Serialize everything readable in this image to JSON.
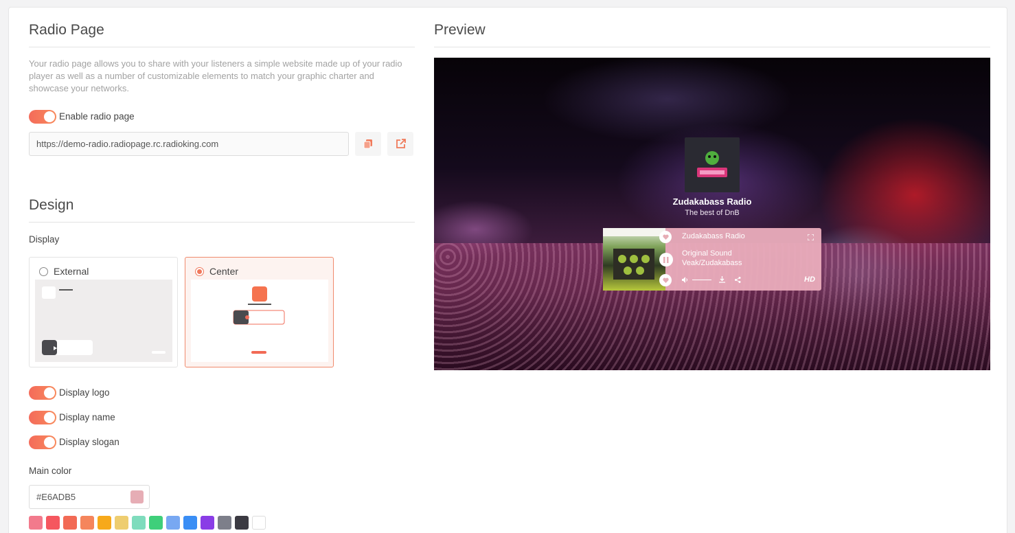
{
  "radio_page": {
    "title": "Radio Page",
    "description": "Your radio page allows you to share with your listeners a simple website made up of your radio player as well as a number of customizable elements to match your graphic charter and showcase your networks.",
    "enable_label": "Enable radio page",
    "enabled": true,
    "url": "https://demo-radio.radiopage.rc.radioking.com",
    "copy_icon": "copy-icon",
    "open_icon": "external-link-icon"
  },
  "design": {
    "title": "Design",
    "display_label": "Display",
    "options": [
      {
        "label": "External",
        "selected": false
      },
      {
        "label": "Center",
        "selected": true
      }
    ],
    "toggles": [
      {
        "label": "Display logo",
        "on": true
      },
      {
        "label": "Display name",
        "on": true
      },
      {
        "label": "Display slogan",
        "on": true
      }
    ],
    "main_color_label": "Main color",
    "main_color_value": "#E6ADB5",
    "swatches": [
      "#f27a8c",
      "#f5575f",
      "#f26a55",
      "#f5855c",
      "#f7a91a",
      "#eecd70",
      "#7fdcbd",
      "#3fcf7a",
      "#78a8f2",
      "#3a8ef5",
      "#8a3de6",
      "#7d7f8a",
      "#3b3a42",
      "#ffffff"
    ]
  },
  "preview": {
    "title": "Preview",
    "station_name": "Zudakabass Radio",
    "station_slogan": "The best of DnB",
    "player": {
      "station": "Zudakabass Radio",
      "track": "Original Sound",
      "artist": "Veak/Zudakabass",
      "quality": "HD"
    }
  },
  "colors": {
    "accent": "#f46b5a",
    "player_bg": "#E6ADB5"
  }
}
